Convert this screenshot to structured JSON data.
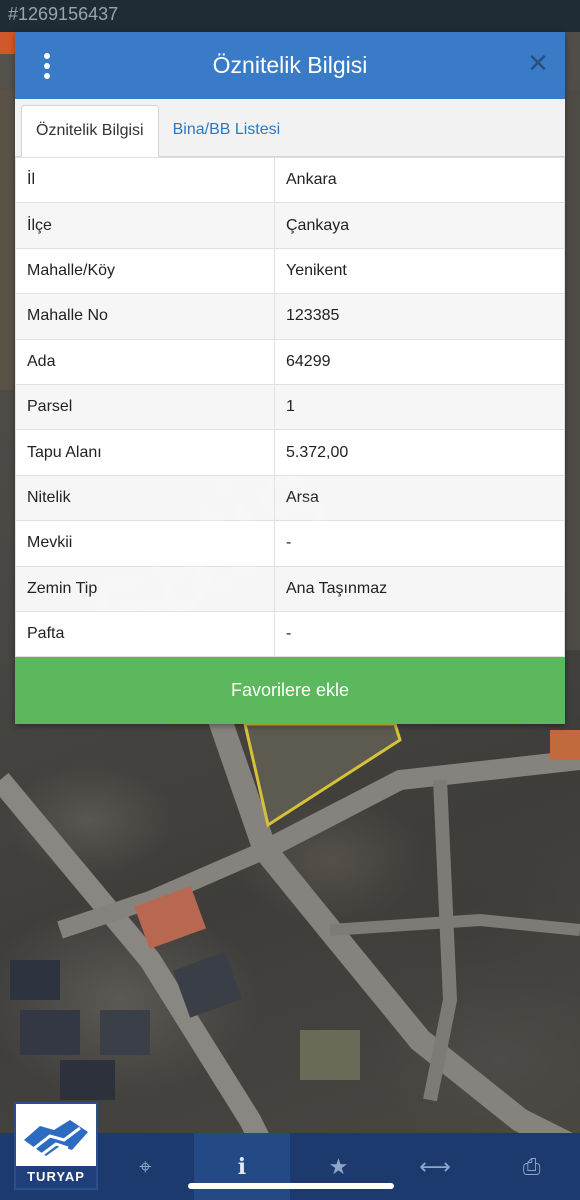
{
  "image_watermark": "#1269156437",
  "map_watermark": "satis",
  "panel": {
    "title": "Öznitelik Bilgisi",
    "tabs": [
      {
        "label": "Öznitelik Bilgisi",
        "active": true
      },
      {
        "label": "Bina/BB Listesi",
        "active": false
      }
    ],
    "rows": [
      {
        "key": "İl",
        "value": "Ankara"
      },
      {
        "key": "İlçe",
        "value": "Çankaya"
      },
      {
        "key": "Mahalle/Köy",
        "value": "Yenikent"
      },
      {
        "key": "Mahalle No",
        "value": "123385"
      },
      {
        "key": "Ada",
        "value": "64299"
      },
      {
        "key": "Parsel",
        "value": "1"
      },
      {
        "key": "Tapu Alanı",
        "value": "5.372,00"
      },
      {
        "key": "Nitelik",
        "value": "Arsa"
      },
      {
        "key": "Mevkii",
        "value": "-"
      },
      {
        "key": "Zemin Tip",
        "value": "Ana Taşınmaz"
      },
      {
        "key": "Pafta",
        "value": "-"
      }
    ],
    "favorite_label": "Favorilere ekle"
  },
  "toolbar": {
    "logo_text": "TURYAP",
    "buttons": [
      {
        "name": "locate-icon",
        "glyph": "⌖",
        "active": false
      },
      {
        "name": "info-icon",
        "glyph": "i",
        "active": true
      },
      {
        "name": "star-icon",
        "glyph": "★",
        "active": false
      },
      {
        "name": "measure-icon",
        "glyph": "⟷",
        "active": false
      },
      {
        "name": "print-icon",
        "glyph": "⎙",
        "active": false
      }
    ]
  },
  "colors": {
    "header": "#3a7bc8",
    "favorite": "#5cb85c",
    "toolbar": "#1c3a6e",
    "tab_link": "#2a78c2",
    "parcel_outline": "#d6c23a"
  }
}
